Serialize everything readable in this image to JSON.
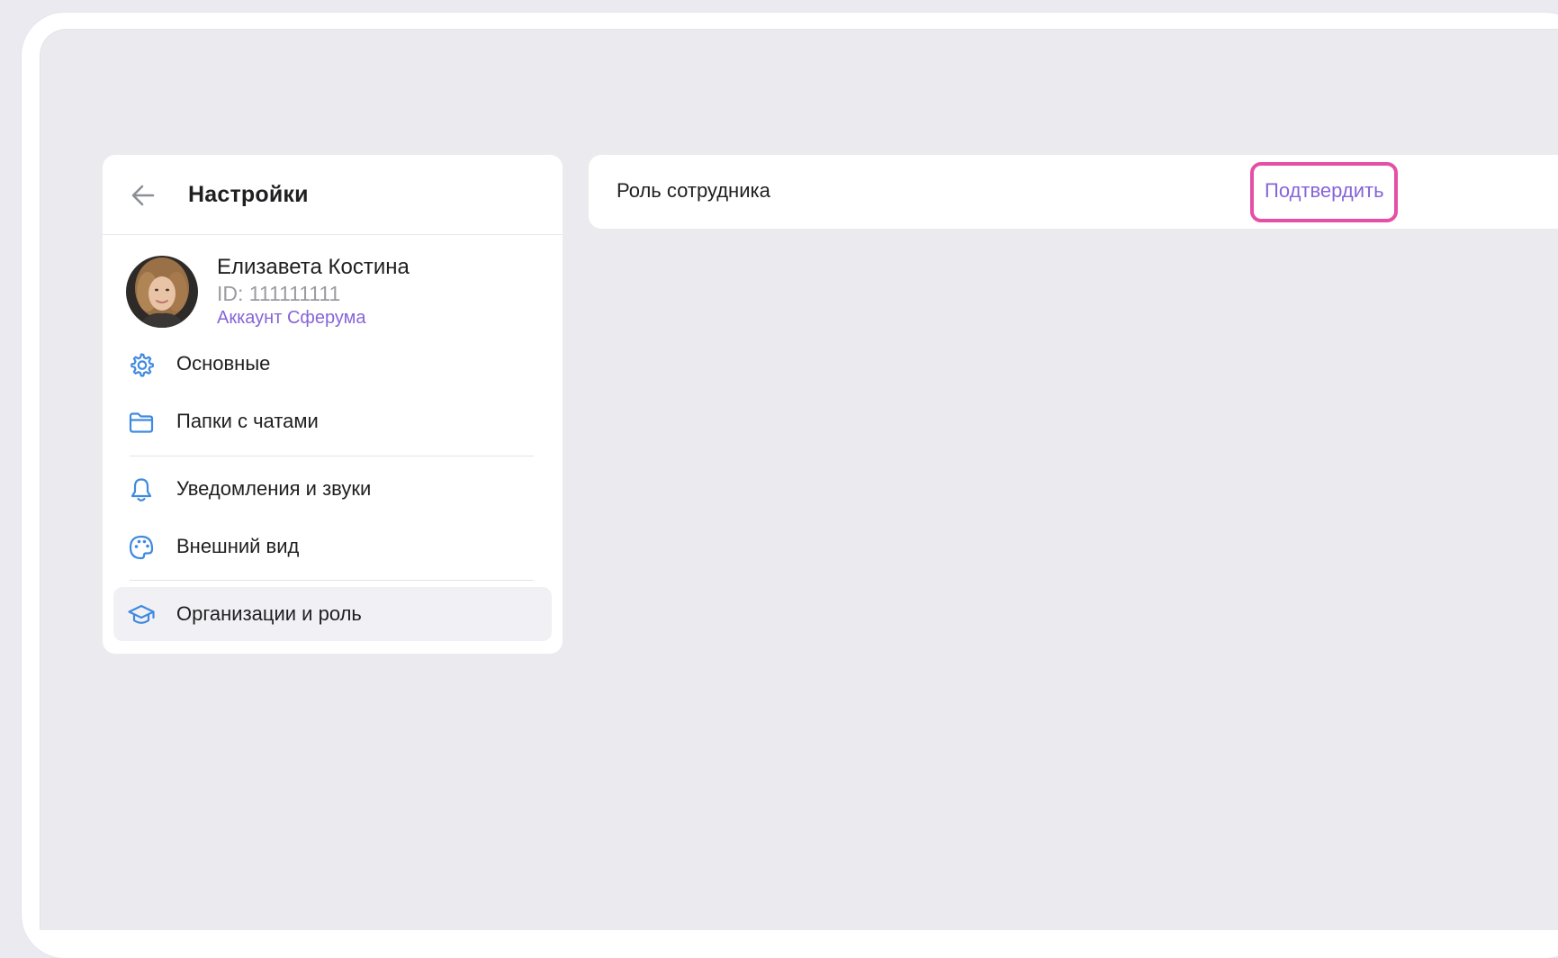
{
  "settings": {
    "title": "Настройки",
    "back_icon": "arrow-left-icon"
  },
  "profile": {
    "name": "Елизавета Костина",
    "id_text": "ID: 111111111",
    "account_label": "Аккаунт Сферума"
  },
  "menu": {
    "items": [
      {
        "label": "Основные",
        "icon": "gear-icon"
      },
      {
        "label": "Папки с чатами",
        "icon": "folder-icon"
      },
      {
        "label": "Уведомления и звуки",
        "icon": "bell-icon"
      },
      {
        "label": "Внешний вид",
        "icon": "palette-icon"
      },
      {
        "label": "Организации и роль",
        "icon": "graduation-cap-icon",
        "active": true
      }
    ]
  },
  "role_panel": {
    "title": "Роль сотрудника",
    "confirm_label": "Подтвердить"
  },
  "colors": {
    "accent": "#8665d8",
    "icon_blue": "#3f8ae0",
    "highlight": "#e54fa6",
    "background": "#ebebef"
  }
}
